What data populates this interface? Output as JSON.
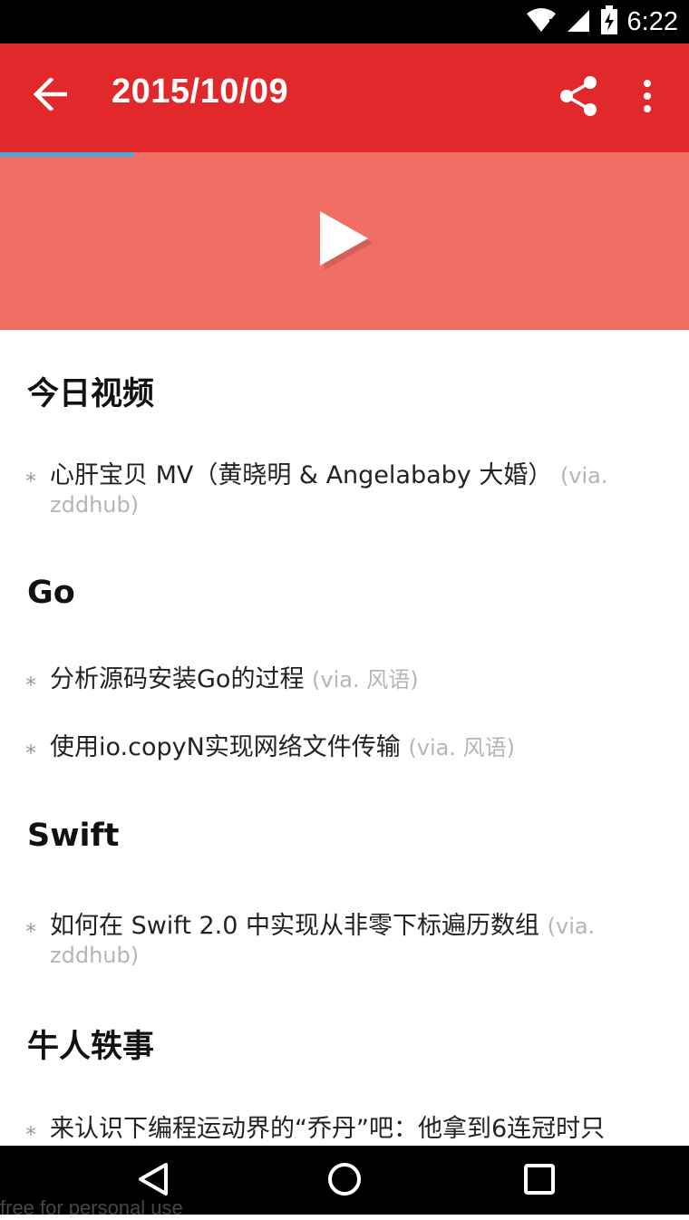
{
  "status_bar": {
    "time": "6:22"
  },
  "app_bar": {
    "title": "2015/10/09"
  },
  "sections": [
    {
      "heading": "今日视频",
      "items": [
        {
          "text": "心肝宝贝 MV（黄晓明 & Angelababy 大婚）",
          "via": "(via. zddhub)"
        }
      ]
    },
    {
      "heading": "Go",
      "items": [
        {
          "text": "分析源码安装Go的过程",
          "via": "(via. 风语)"
        },
        {
          "text": "使用io.copyN实现网络文件传输",
          "via": "(via. 风语)"
        }
      ]
    },
    {
      "heading": "Swift",
      "items": [
        {
          "text": "如何在 Swift 2.0 中实现从非零下标遍历数组",
          "via": "(via. zddhub)"
        }
      ]
    },
    {
      "heading": "牛人轶事",
      "items": [
        {
          "text": "来认识下编程运动界的“乔丹”吧：他拿到6连冠时只",
          "via": ""
        }
      ]
    }
  ],
  "bullet": "*",
  "watermark": "free for personal use",
  "colors": {
    "app_bar": "#e1292c",
    "video_banner": "#f06e63",
    "progress": "#4aa8d8"
  }
}
